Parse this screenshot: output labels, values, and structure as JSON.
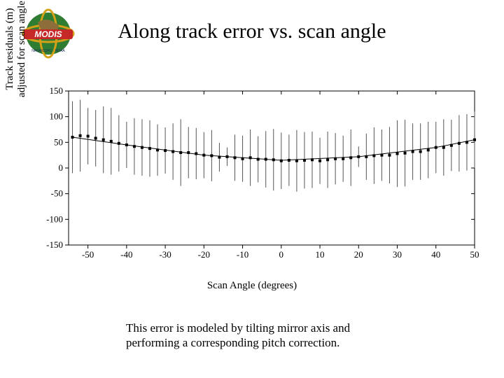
{
  "title": "Along track error vs. scan angle",
  "caption": "This error is modeled by tilting mirror axis and performing a corresponding pitch correction.",
  "logo": {
    "name": "MODIS"
  },
  "ylabel_line1": "Track residuals (m)",
  "ylabel_line2": "adjusted for scan angle",
  "xlabel": "Scan Angle (degrees)",
  "chart_data": {
    "type": "scatter",
    "title": "Along track error vs. scan angle",
    "xlabel": "Scan Angle (degrees)",
    "ylabel": "Track residuals (m) adjusted for scan angle",
    "xlim": [
      -55,
      50
    ],
    "ylim": [
      -150,
      150
    ],
    "xticks": [
      -50,
      -40,
      -30,
      -20,
      -10,
      0,
      10,
      20,
      30,
      40,
      50
    ],
    "yticks": [
      -150,
      -100,
      -50,
      0,
      50,
      100,
      150
    ],
    "series": [
      {
        "name": "residuals",
        "x": [
          -54,
          -52,
          -50,
          -48,
          -46,
          -44,
          -42,
          -40,
          -38,
          -36,
          -34,
          -32,
          -30,
          -28,
          -26,
          -24,
          -22,
          -20,
          -18,
          -16,
          -14,
          -12,
          -10,
          -8,
          -6,
          -4,
          -2,
          0,
          2,
          4,
          6,
          8,
          10,
          12,
          14,
          16,
          18,
          20,
          22,
          24,
          26,
          28,
          30,
          32,
          34,
          36,
          38,
          40,
          42,
          44,
          46,
          48,
          50
        ],
        "y": [
          60,
          63,
          62,
          58,
          55,
          52,
          48,
          45,
          42,
          40,
          38,
          35,
          34,
          32,
          30,
          30,
          28,
          25,
          24,
          21,
          22,
          20,
          18,
          20,
          17,
          17,
          16,
          14,
          15,
          14,
          15,
          16,
          14,
          16,
          18,
          18,
          20,
          22,
          22,
          24,
          25,
          25,
          28,
          29,
          32,
          32,
          35,
          40,
          40,
          44,
          48,
          50,
          55
        ],
        "yerr": [
          70,
          70,
          55,
          55,
          65,
          65,
          55,
          45,
          55,
          55,
          55,
          50,
          45,
          55,
          65,
          50,
          50,
          45,
          50,
          28,
          18,
          45,
          45,
          55,
          45,
          55,
          60,
          55,
          50,
          60,
          55,
          55,
          45,
          55,
          50,
          45,
          55,
          20,
          45,
          55,
          50,
          55,
          65,
          65,
          55,
          55,
          55,
          50,
          55,
          50,
          55,
          55,
          55
        ]
      }
    ],
    "fit": {
      "x": [
        -54,
        -40,
        -20,
        0,
        20,
        40,
        50
      ],
      "y": [
        60,
        45,
        25,
        15,
        22,
        40,
        55
      ]
    }
  }
}
